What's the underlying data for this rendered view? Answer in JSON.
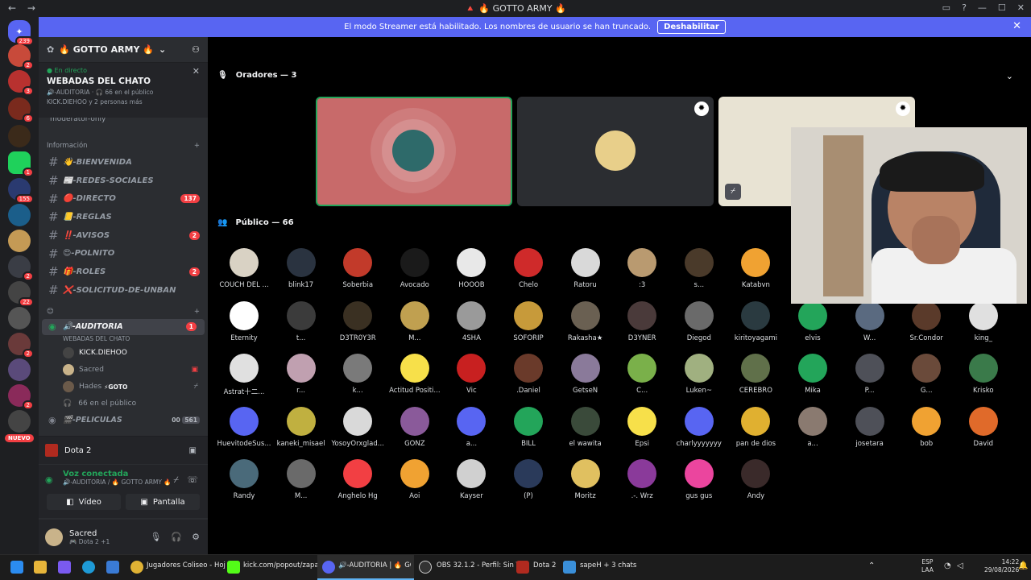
{
  "window": {
    "title": "🔺 🔥 GOTTO ARMY 🔥",
    "back": "←",
    "forward": "→"
  },
  "banner": {
    "text": "El modo Streamer está habilitado. Los nombres de usuario se han truncado.",
    "button": "Deshabilitar"
  },
  "guilds": {
    "home_badge": "239",
    "new_label": "NUEVO",
    "badges": [
      "2",
      "3",
      "6",
      "1",
      "155",
      "2",
      "22",
      "2",
      "2"
    ]
  },
  "server": {
    "name": "🔥 GOTTO ARMY 🔥",
    "stage": {
      "live_label": "En directo",
      "name": "WEBADAS DEL CHATO",
      "channel": "🔊-AUDITORIA · 🎧 66 en el público",
      "listeners": "KICK.DIEHOO y 2 personas más"
    },
    "moderator": "moderator-only",
    "category_info": "Información",
    "channels": [
      {
        "name": "👋-BIENVENIDA",
        "badge": ""
      },
      {
        "name": "📰-REDES-SOCIALES",
        "badge": ""
      },
      {
        "name": "🔴-DIRECTO",
        "badge": "137"
      },
      {
        "name": "📒-REGLAS",
        "badge": ""
      },
      {
        "name": "‼️-AVISOS",
        "badge": "2"
      },
      {
        "name": "😍-POLNITO",
        "badge": ""
      },
      {
        "name": "🎁-ROLES",
        "badge": "2"
      },
      {
        "name": "❌-SOLICITUD-DE-UNBAN",
        "badge": ""
      }
    ],
    "voice_category": "😊",
    "stage_channel": {
      "name": "🔊-AUDITORIA",
      "topic": "WEBADAS DEL CHATO",
      "badge": "1"
    },
    "voice_users": [
      "KICK.DIEHOO",
      "Sacred",
      "Hades",
      "66 en el público"
    ],
    "hades_tag": "⚡GOTO",
    "next_channel": {
      "name": "🎬-PELICULAS",
      "count_a": "00",
      "count_b": "561"
    }
  },
  "activity": {
    "game": "Dota 2"
  },
  "voice": {
    "status": "Voz conectada",
    "location": "🔊-AUDITORIA / 🔥 GOTTO ARMY 🔥",
    "video": "Vídeo",
    "screen": "Pantalla"
  },
  "user": {
    "name": "Sacred",
    "status": "🎮 Dota 2 +1"
  },
  "stage": {
    "speakers_title": "Oradores — 3",
    "audience_title": "Público — 66"
  },
  "audience": [
    "COUCH DEL ...",
    "blink17",
    "Soberbia",
    "Avocado",
    "HOOOB",
    "Chelo",
    "Ratoru",
    ":3",
    "s...",
    "Katabvn",
    "Eternity",
    "t...",
    "D3TR0Y3R",
    "M...",
    "4SHA",
    "SOFORIP",
    "Rakasha★",
    "D3YNER",
    "Diegod",
    "kiritoyagami",
    "elvis",
    "W...",
    "Sr.Condor",
    "king_",
    "Astrat十二...",
    "r...",
    "k...",
    "Actitud Positi...",
    "Vic",
    ".Daniel",
    "GetseN",
    "C...",
    "Luken~",
    "CEREBRO",
    "Mika",
    "P...",
    "G...",
    "Krisko",
    "HuevitodeSus...",
    "kaneki_misael",
    "YosoyOrxglad...",
    "GONZ",
    "a...",
    "BILL",
    "el wawita",
    "Epsi",
    "charlyyyyyyy",
    "pan de dios",
    "a...",
    "josetara",
    "bob",
    "David",
    "Randy",
    "M...",
    "Anghelo Hg",
    "Aoi",
    "Kayser",
    "(P)",
    "Moritz",
    ".-. Wrz",
    "gus gus",
    "Andy"
  ],
  "taskbar": {
    "items": [
      "Jugadores Coliseo - Hoj",
      "kick.com/popout/zapati",
      "🔊-AUDITORIA | 🔥 GO",
      "OBS 32.1.2 - Perfil: Sin Tí",
      "Dota 2",
      "sapeH + 3 chats"
    ],
    "lang": "ESP",
    "lang2": "LAA",
    "time": "14:22",
    "date": "29/08/2026"
  },
  "colors": {
    "accent": "#5865f2",
    "online": "#23a55a",
    "danger": "#f23f43"
  }
}
